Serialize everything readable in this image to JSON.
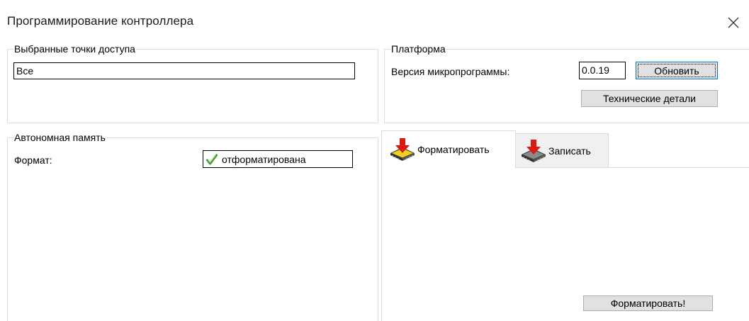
{
  "window": {
    "title": "Программирование контроллера"
  },
  "access_points": {
    "group_label": "Выбранные точки доступа",
    "value": "Все"
  },
  "platform": {
    "group_label": "Платформа",
    "firmware_label": "Версия микропрограммы:",
    "firmware_value": "0.0.19",
    "refresh_button": "Обновить",
    "details_button": "Технические детали"
  },
  "autonomous_memory": {
    "group_label": "Автономная память",
    "format_label": "Формат:",
    "format_value": "отформатирована",
    "format_status_icon": "check-icon"
  },
  "tabs": [
    {
      "label": "Форматировать",
      "icon": "chip-arrow-down-icon",
      "active": true
    },
    {
      "label": "Записать",
      "icon": "chip-arrow-down-icon",
      "active": false
    }
  ],
  "format_tab": {
    "format_button": "Форматировать!"
  },
  "colors": {
    "focus_border": "#0078d7",
    "button_face": "#e1e1e1",
    "arrow_red": "#e0190f",
    "chip_yellow": "#f0d020",
    "check_green": "#3a9a2a"
  }
}
